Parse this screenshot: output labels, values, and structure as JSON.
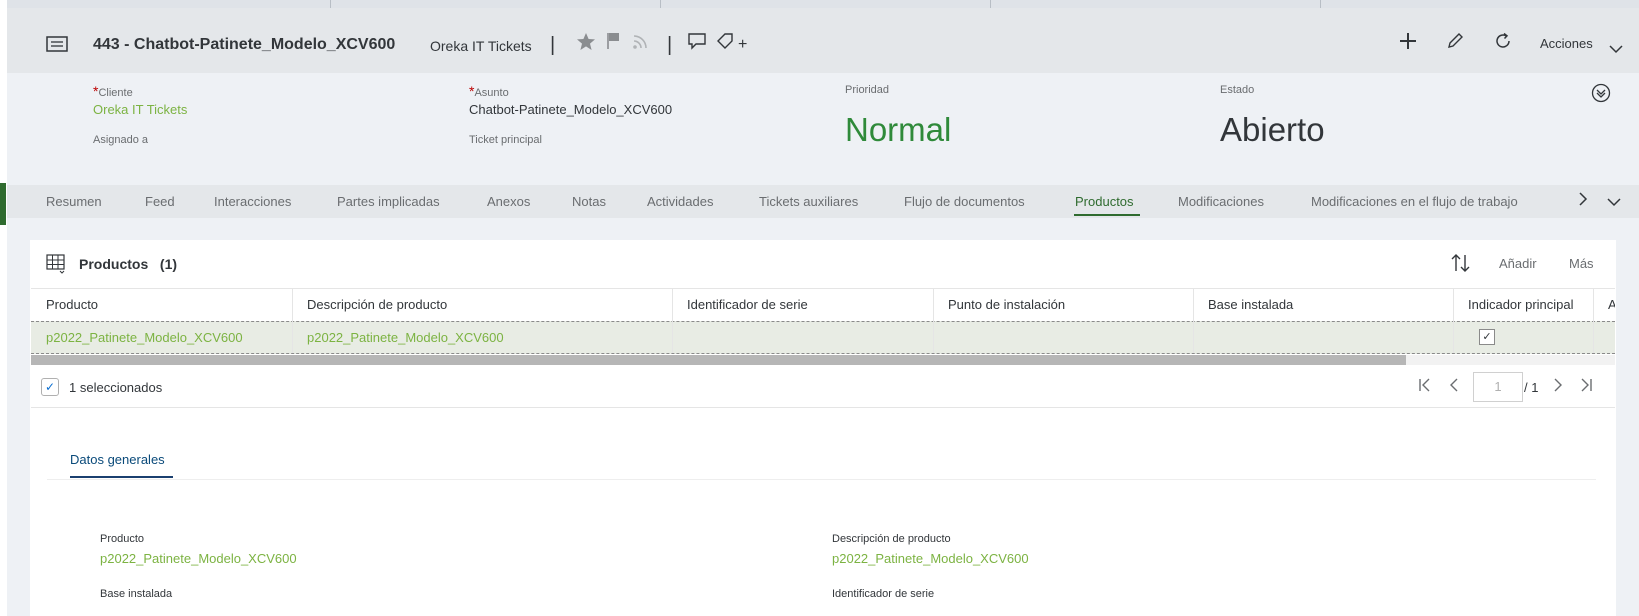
{
  "header": {
    "title": "443 - Chatbot-Patinete_Modelo_XCV600",
    "subtitle": "Oreka IT Tickets",
    "separator": "|",
    "add_glyph": "+",
    "acciones_label": "Acciones"
  },
  "fields": {
    "cliente_label": "Cliente",
    "cliente_value": "Oreka IT Tickets",
    "asignado_label": "Asignado a",
    "asunto_label": "Asunto",
    "asunto_value": "Chatbot-Patinete_Modelo_XCV600",
    "ticket_principal_label": "Ticket principal",
    "prioridad_label": "Prioridad",
    "prioridad_value": "Normal",
    "estado_label": "Estado",
    "estado_value": "Abierto",
    "required_marker": "*"
  },
  "tabs": [
    {
      "label": "Resumen"
    },
    {
      "label": "Feed"
    },
    {
      "label": "Interacciones"
    },
    {
      "label": "Partes implicadas"
    },
    {
      "label": "Anexos"
    },
    {
      "label": "Notas"
    },
    {
      "label": "Actividades"
    },
    {
      "label": "Tickets auxiliares"
    },
    {
      "label": "Flujo de documentos"
    },
    {
      "label": "Productos"
    },
    {
      "label": "Modificaciones"
    },
    {
      "label": "Modificaciones en el flujo de trabajo"
    }
  ],
  "products": {
    "title": "Productos",
    "count": "(1)",
    "add_label": "Añadir",
    "more_label": "Más",
    "columns": [
      "Producto",
      "Descripción de producto",
      "Identificador de serie",
      "Punto de instalación",
      "Base instalada",
      "Indicador principal",
      "A"
    ],
    "rows": [
      {
        "producto": "p2022_Patinete_Modelo_XCV600",
        "descripcion": "p2022_Patinete_Modelo_XCV600",
        "indicador": "✓"
      }
    ],
    "selected_text": "1 seleccionados",
    "page_placeholder": "1",
    "page_total": "/ 1"
  },
  "details": {
    "tab_label": "Datos generales",
    "producto_label": "Producto",
    "producto_value": "p2022_Patinete_Modelo_XCV600",
    "descripcion_label": "Descripción de producto",
    "descripcion_value": "p2022_Patinete_Modelo_XCV600",
    "base_label": "Base instalada",
    "serie_label": "Identificador de serie"
  },
  "colors": {
    "link_green": "#7cb342",
    "active_green": "#2f6b2f",
    "header_bg": "#e4e7ea",
    "content_bg": "#eef1f5"
  }
}
